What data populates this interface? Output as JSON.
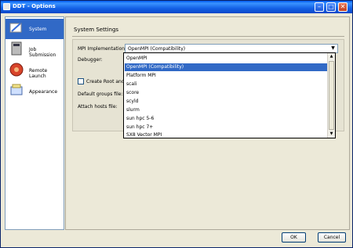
{
  "window": {
    "title": "DDT - Options"
  },
  "titlebar": {
    "minimize": "–",
    "maximize": "□",
    "close": "✕"
  },
  "sidebar": {
    "items": [
      {
        "label": "System",
        "icon": "system-icon",
        "active": true
      },
      {
        "label": "Job Submission",
        "icon": "job-submission-icon",
        "active": false
      },
      {
        "label": "Remote Launch",
        "icon": "remote-launch-icon",
        "active": false
      },
      {
        "label": "Appearance",
        "icon": "appearance-icon",
        "active": false
      }
    ]
  },
  "main": {
    "section_title": "System Settings",
    "mpi_label": "MPI Implementation:",
    "mpi_value": "OpenMPI (Compatibility)",
    "debugger_label": "Debugger:",
    "create_root_label": "Create Root and W",
    "default_groups_label": "Default groups file:",
    "attach_hosts_label": "Attach hosts file:"
  },
  "dropdown": {
    "options": [
      "OpenMPI",
      "OpenMPI (Compatibility)",
      "Platform MPI",
      "scali",
      "score",
      "scyld",
      "slurm",
      "sun hpc 5-6",
      "sun hpc 7+",
      "SX8 Vector MPI"
    ],
    "selected": "OpenMPI (Compatibility)"
  },
  "buttons": {
    "ok": "OK",
    "cancel": "Cancel"
  },
  "colors": {
    "selection": "#3169c6",
    "titlebar": "#0058ee"
  }
}
